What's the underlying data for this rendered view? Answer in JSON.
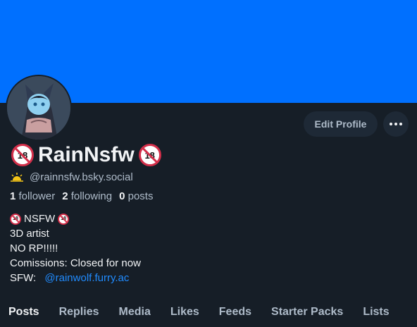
{
  "banner": {
    "color": "#0070ff"
  },
  "header": {
    "edit_profile": "Edit Profile",
    "more_icon": "ellipsis-icon"
  },
  "profile": {
    "display_name": "RainNsfw",
    "badge_icon": "no-under-18-icon",
    "handle_icon": "sunrise-icon",
    "handle": "@rainnsfw.bsky.social"
  },
  "stats": {
    "followers_count": "1",
    "followers_label": "follower",
    "following_count": "2",
    "following_label": "following",
    "posts_count": "0",
    "posts_label": "posts"
  },
  "bio": {
    "line1": "NSFW",
    "line2": "3D artist",
    "line3": "NO RP!!!!!",
    "line4": "Comissions: Closed for now",
    "line5_prefix": "SFW: ",
    "line5_link": "@rainwolf.furry.ac"
  },
  "tabs": [
    {
      "label": "Posts",
      "active": true
    },
    {
      "label": "Replies"
    },
    {
      "label": "Media"
    },
    {
      "label": "Likes"
    },
    {
      "label": "Feeds"
    },
    {
      "label": "Starter Packs"
    },
    {
      "label": "Lists"
    }
  ],
  "colors": {
    "background": "#161e27",
    "accent": "#208bfe",
    "muted_text": "#aebbc9"
  }
}
